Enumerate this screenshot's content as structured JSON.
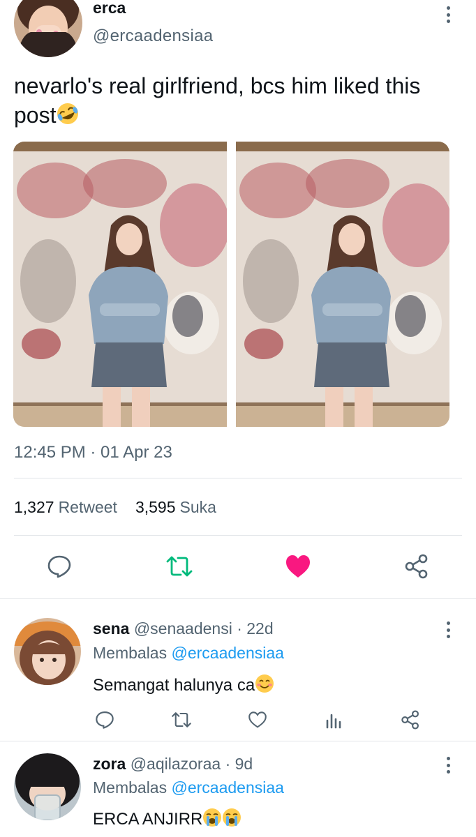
{
  "tweet": {
    "display_name": "erca",
    "handle": "@ercaadensiaa",
    "text": "nevarlo's real girlfriend, bcs him liked this post",
    "text_emoji": "rolling-on-floor-laughing-emoji",
    "timestamp": "12:45 PM · 01 Apr 23",
    "retweets_count": "1,327",
    "retweets_label": "Retweet",
    "likes_count": "3,595",
    "likes_label": "Suka",
    "liked": true,
    "colors": {
      "like": "#f91880",
      "retweet": "#00ba7c",
      "icon": "#536471",
      "link": "#1d9bf0"
    },
    "actions": [
      "reply-icon",
      "retweet-icon",
      "like-icon",
      "share-icon"
    ]
  },
  "replies": [
    {
      "display_name": "sena",
      "handle": "@senaadensi",
      "time": "· 22d",
      "replying_label": "Membalas",
      "replying_to": "@ercaadensiaa",
      "text": "Semangat halunya ca",
      "text_emoji": "smiling-face-emoji",
      "actions": [
        "reply-icon",
        "retweet-icon",
        "like-icon",
        "analytics-icon",
        "share-icon"
      ]
    },
    {
      "display_name": "zora",
      "handle": "@aqilazoraa",
      "time": "· 9d",
      "replying_label": "Membalas",
      "replying_to": "@ercaadensiaa",
      "text": "ERCA ANJIRR",
      "text_emoji": "loudly-crying-face-emoji"
    }
  ]
}
